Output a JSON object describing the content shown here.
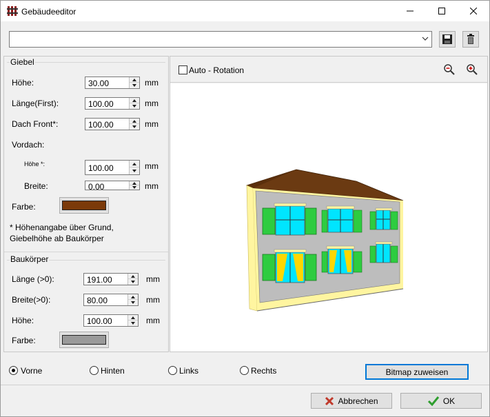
{
  "window": {
    "title": "Gebäudeeditor"
  },
  "combo": {
    "value": ""
  },
  "giebel": {
    "title": "Giebel",
    "hoehe_label": "Höhe:",
    "hoehe_value": "30.00",
    "hoehe_unit": "mm",
    "laenge_label": "Länge(First):",
    "laenge_value": "100.00",
    "laenge_unit": "mm",
    "dachfront_label": "Dach Front*:",
    "dachfront_value": "100.00",
    "dachfront_unit": "mm",
    "vordach_label": "Vordach:",
    "vordach_hoehe_label": "Höhe *:",
    "vordach_hoehe_value": "100.00",
    "vordach_hoehe_unit": "mm",
    "vordach_breite_label": "Breite:",
    "vordach_breite_value": "0.00",
    "vordach_breite_unit": "mm",
    "farbe_label": "Farbe:",
    "farbe_color": "#7b3a0a",
    "note_line1": "* Höhenangabe über Grund,",
    "note_line2": "Giebelhöhe ab Baukörper"
  },
  "baukoerper": {
    "title": "Baukörper",
    "laenge_label": "Länge (>0):",
    "laenge_value": "191.00",
    "laenge_unit": "mm",
    "breite_label": "Breite(>0):",
    "breite_value": "80.00",
    "breite_unit": "mm",
    "hoehe_label": "Höhe:",
    "hoehe_value": "100.00",
    "hoehe_unit": "mm",
    "farbe_label": "Farbe:",
    "farbe_color": "#9a9a9a"
  },
  "view": {
    "auto_rotation_label": "Auto - Rotation"
  },
  "sides": {
    "vorne": "Vorne",
    "hinten": "Hinten",
    "links": "Links",
    "rechts": "Rechts"
  },
  "buttons": {
    "bitmap": "Bitmap zuweisen",
    "cancel": "Abbrechen",
    "ok": "OK"
  }
}
